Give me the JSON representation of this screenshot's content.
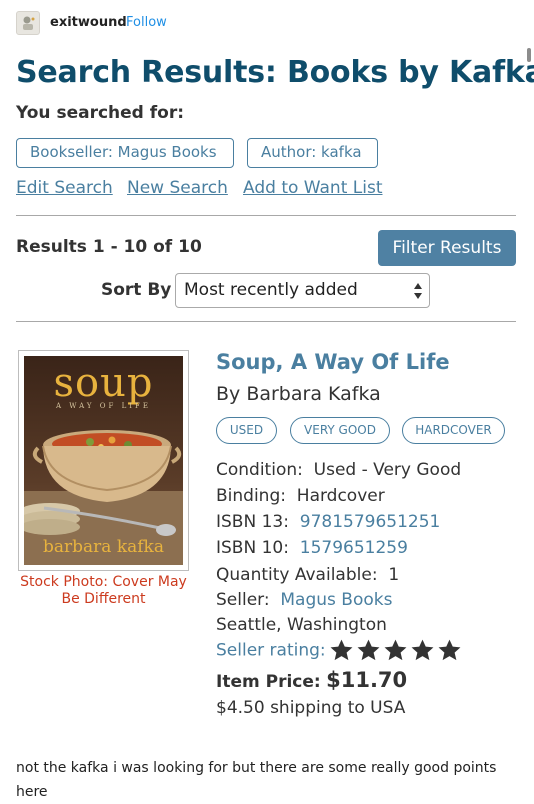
{
  "post": {
    "username": "exitwound",
    "follow_label": "Follow",
    "caption": "not the kafka i was looking for but there are some really good points here"
  },
  "page": {
    "title": "Search Results: Books by Kafka",
    "searched_for_label": "You searched for:",
    "filters": [
      "Bookseller: Magus Books",
      "Author: kafka"
    ],
    "links": [
      "Edit Search",
      "New Search",
      "Add to Want List"
    ],
    "results_count": "Results 1 - 10 of 10",
    "filter_button": "Filter Results",
    "sort_label": "Sort By",
    "sort_value": "Most recently added"
  },
  "listing": {
    "cover": {
      "title": "soup",
      "subtitle": "A WAY OF LIFE",
      "author": "barbara kafka"
    },
    "stock_note": "Stock Photo: Cover May Be Different",
    "title": "Soup, A Way Of Life",
    "author_line": "By Barbara Kafka",
    "badges": [
      "USED",
      "VERY GOOD",
      "HARDCOVER"
    ],
    "condition_label": "Condition:",
    "condition_value": "Used - Very Good",
    "binding_label": "Binding:",
    "binding_value": "Hardcover",
    "isbn13_label": "ISBN 13:",
    "isbn13_value": "9781579651251",
    "isbn10_label": "ISBN 10:",
    "isbn10_value": "1579651259",
    "quantity_label": "Quantity Available:",
    "quantity_value": "1",
    "seller_label": "Seller:",
    "seller_value": "Magus Books",
    "seller_location": "Seattle, Washington",
    "seller_rating_label": "Seller rating:",
    "seller_rating_stars": 5,
    "price_label": "Item Price:",
    "price_value": "$11.70",
    "shipping": "$4.50 shipping to USA"
  },
  "colors": {
    "title": "#0f4d6b",
    "accent": "#4a7fa0",
    "button": "#4f81a3",
    "stock_note": "#cc3b1f",
    "follow": "#1f8fe5"
  },
  "icons": [
    "avatar-image",
    "select-updown-icon",
    "star-icon"
  ]
}
